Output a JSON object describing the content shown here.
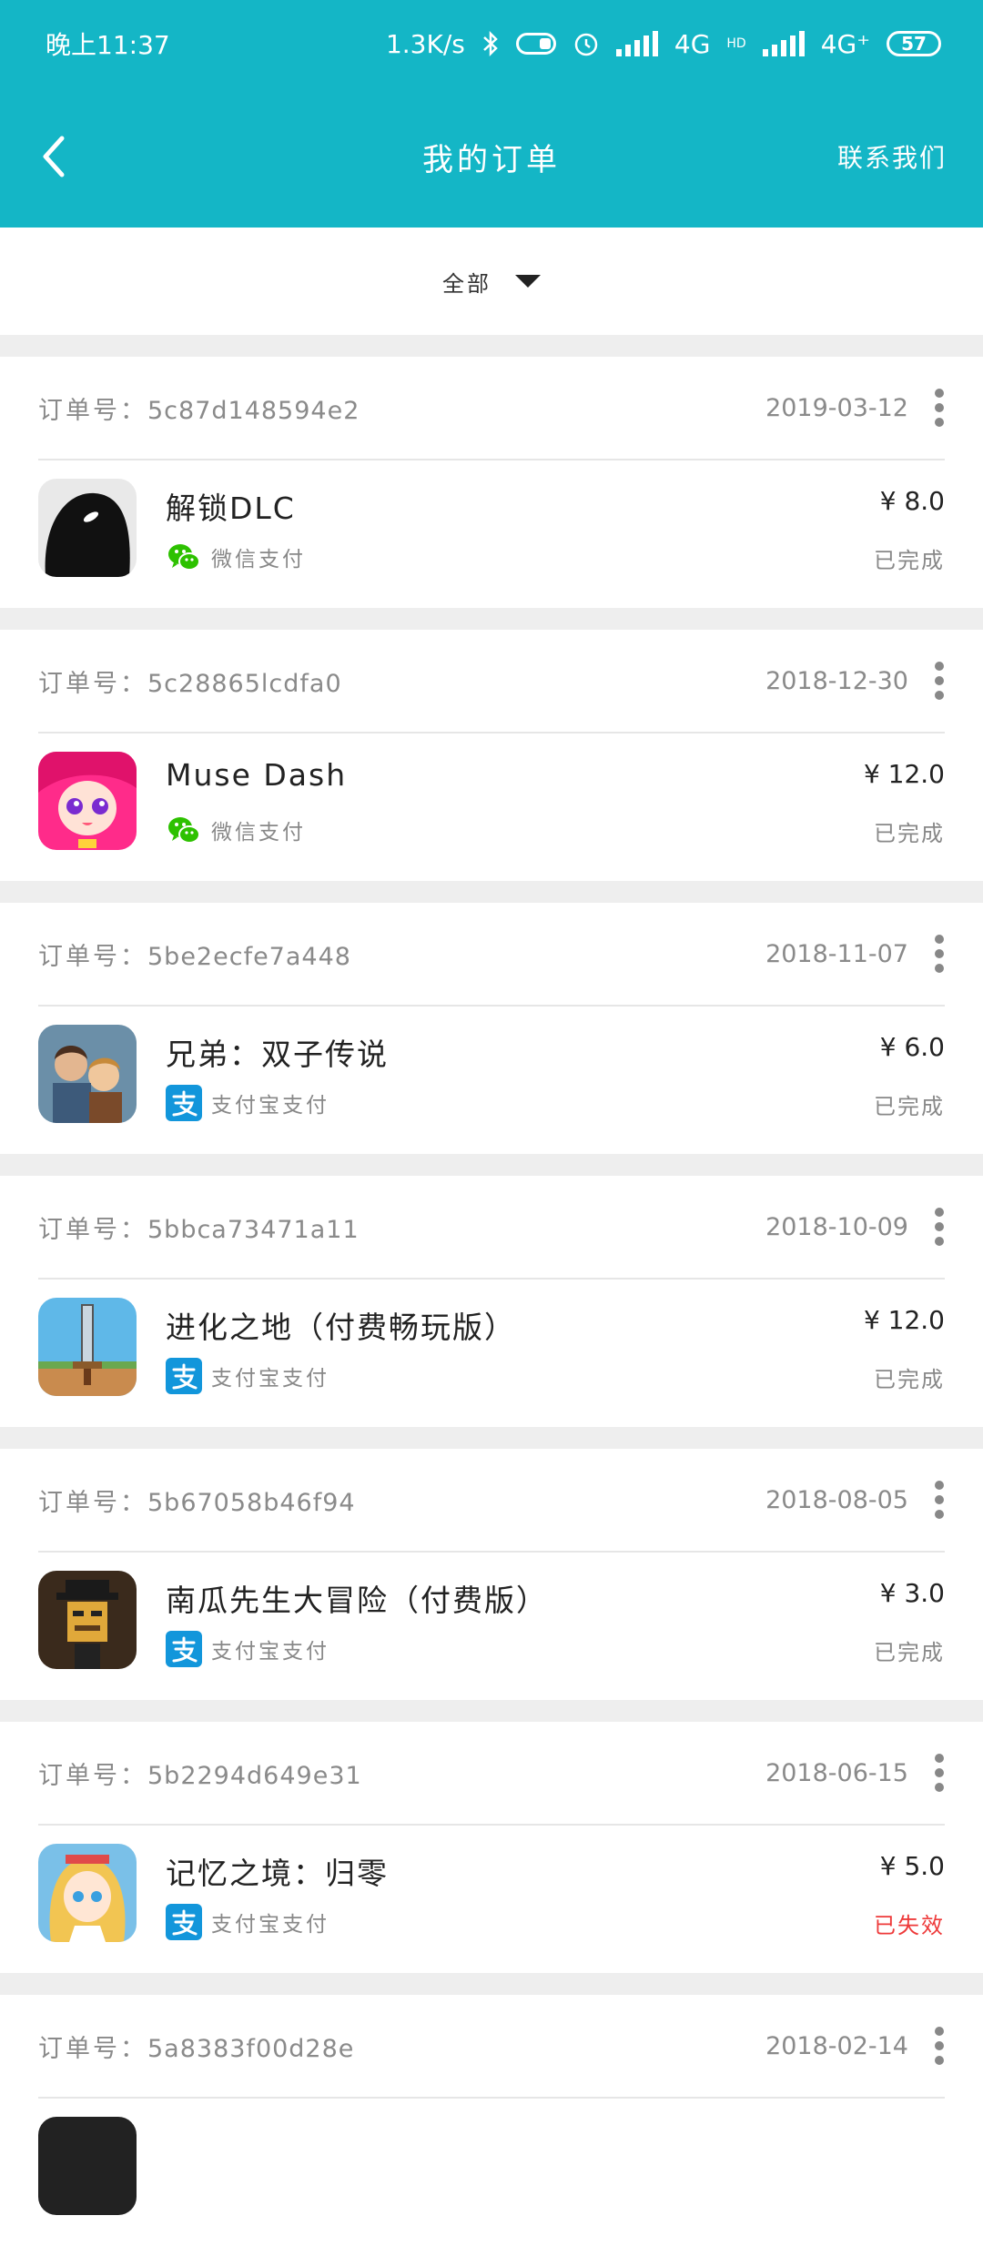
{
  "statusbar": {
    "time": "晚上11:37",
    "net_speed": "1.3K/s",
    "network_1": "4G",
    "hd": "HD",
    "network_2": "4G⁺",
    "battery": "57"
  },
  "navbar": {
    "title": "我的订单",
    "contact": "联系我们"
  },
  "filter": {
    "label": "全部"
  },
  "labels": {
    "order_prefix": "订单号："
  },
  "orders": [
    {
      "order_no": "5c87d148594e2",
      "date": "2019-03-12",
      "name": "解锁DLC",
      "pay": "微信支付",
      "pay_type": "wechat",
      "price": "¥ 8.0",
      "status": "已完成",
      "icon": "dark-creature-icon"
    },
    {
      "order_no": "5c28865lcdfa0",
      "date": "2018-12-30",
      "name": "Muse Dash",
      "pay": "微信支付",
      "pay_type": "wechat",
      "price": "¥ 12.0",
      "status": "已完成",
      "icon": "anime-girl-icon"
    },
    {
      "order_no": "5be2ecfe7a448",
      "date": "2018-11-07",
      "name": "兄弟：双子传说",
      "pay": "支付宝支付",
      "pay_type": "alipay",
      "price": "¥ 6.0",
      "status": "已完成",
      "icon": "brothers-icon"
    },
    {
      "order_no": "5bbca73471a11",
      "date": "2018-10-09",
      "name": "进化之地（付费畅玩版）",
      "pay": "支付宝支付",
      "pay_type": "alipay",
      "price": "¥ 12.0",
      "status": "已完成",
      "icon": "sword-icon"
    },
    {
      "order_no": "5b67058b46f94",
      "date": "2018-08-05",
      "name": "南瓜先生大冒险（付费版）",
      "pay": "支付宝支付",
      "pay_type": "alipay",
      "price": "¥ 3.0",
      "status": "已完成",
      "icon": "mr-pumpkin-icon"
    },
    {
      "order_no": "5b2294d649e31",
      "date": "2018-06-15",
      "name": "记忆之境：归零",
      "pay": "支付宝支付",
      "pay_type": "alipay",
      "price": "¥ 5.0",
      "status": "已失效",
      "icon": "blonde-girl-icon"
    },
    {
      "order_no": "5a8383f00d28e",
      "date": "2018-02-14",
      "name": "",
      "pay": "",
      "pay_type": "",
      "price": "",
      "status": "",
      "icon": "partial-app-icon"
    }
  ],
  "colors": {
    "header": "#14b6c6",
    "status_failed": "#ee3a3a",
    "wechat": "#2dc100",
    "alipay": "#1296db"
  }
}
